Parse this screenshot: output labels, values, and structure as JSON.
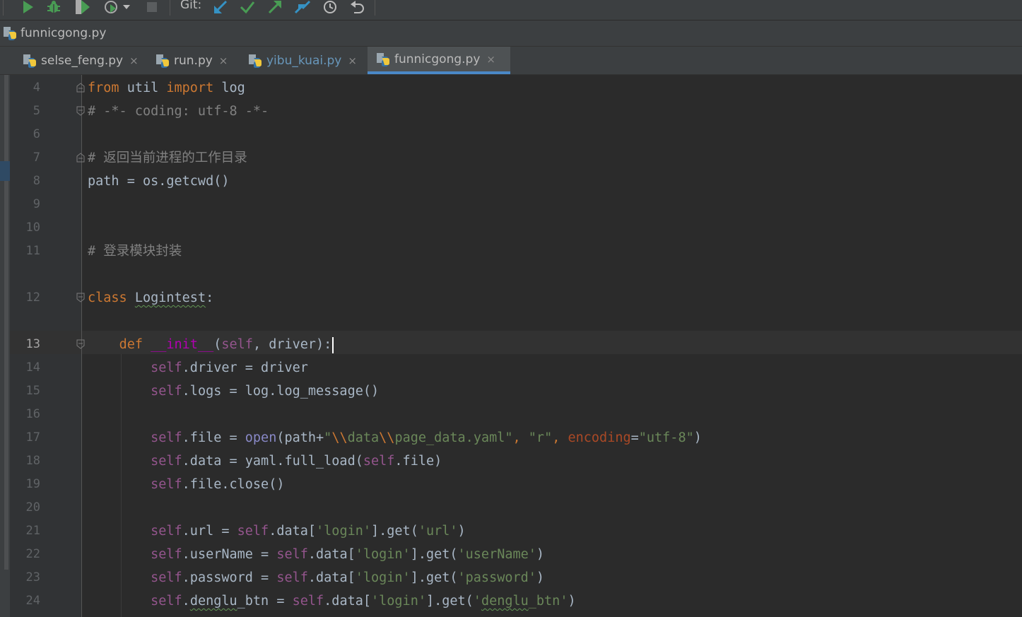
{
  "toolbar": {
    "git_label": "Git:",
    "colors": {
      "run": "#499c54",
      "debug": "#499c54",
      "git_update": "#3592c4",
      "git_commit": "#499c54",
      "git_push": "#499c54"
    }
  },
  "navbar": {
    "file": "funnicgong.py"
  },
  "tabs": [
    {
      "label": "selse_feng.py",
      "close": "×"
    },
    {
      "label": "run.py",
      "close": "×"
    },
    {
      "label": "yibu_kuai.py",
      "close": "×"
    },
    {
      "label": "funnicgong.py",
      "close": "×"
    }
  ],
  "editor": {
    "line_numbers": [
      "4",
      "5",
      "6",
      "7",
      "8",
      "9",
      "10",
      "11",
      "12",
      "13",
      "14",
      "15",
      "16",
      "17",
      "18",
      "19",
      "20",
      "21",
      "22",
      "23",
      "24"
    ],
    "current_line": "13"
  }
}
